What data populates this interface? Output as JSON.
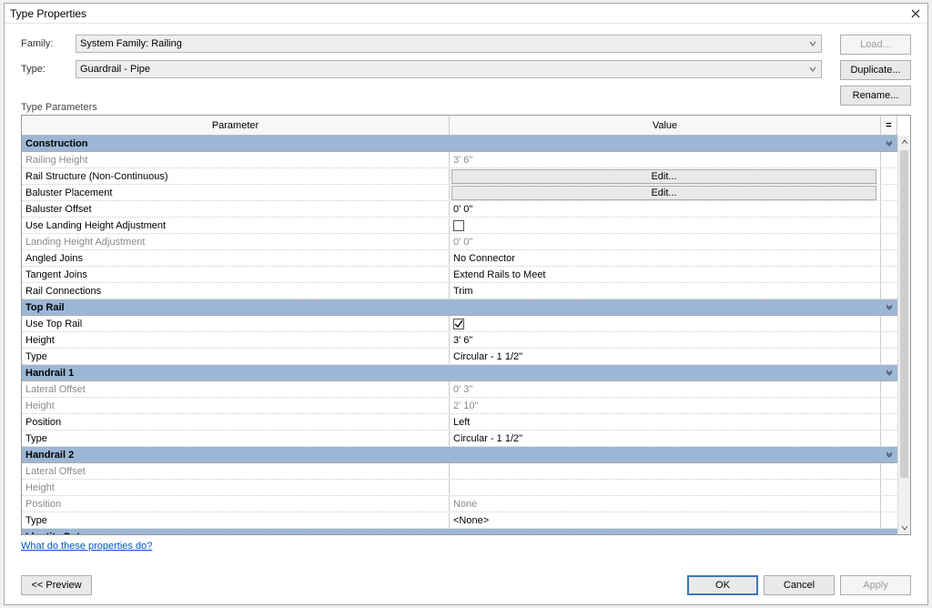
{
  "dialog": {
    "title": "Type Properties"
  },
  "labels": {
    "family": "Family:",
    "type": "Type:",
    "type_parameters": "Type Parameters"
  },
  "family_select": {
    "value": "System Family: Railing"
  },
  "type_select": {
    "value": "Guardrail - Pipe"
  },
  "buttons": {
    "load": "Load...",
    "duplicate": "Duplicate...",
    "rename": "Rename...",
    "preview": "<<  Preview",
    "ok": "OK",
    "cancel": "Cancel",
    "apply": "Apply",
    "edit": "Edit..."
  },
  "columns": {
    "parameter": "Parameter",
    "value": "Value",
    "eq": "="
  },
  "helplink": "What do these properties do?",
  "groups": [
    {
      "name": "Construction",
      "rows": [
        {
          "label": "Railing Height",
          "value": "3'  6\"",
          "dim": true
        },
        {
          "label": "Rail Structure (Non-Continuous)",
          "value": "",
          "edit": true
        },
        {
          "label": "Baluster Placement",
          "value": "",
          "edit": true
        },
        {
          "label": "Baluster Offset",
          "value": "0'  0\""
        },
        {
          "label": "Use Landing Height Adjustment",
          "value": "",
          "checkbox": true,
          "checked": false
        },
        {
          "label": "Landing Height Adjustment",
          "value": "0'  0\"",
          "dim": true
        },
        {
          "label": "Angled Joins",
          "value": "No Connector"
        },
        {
          "label": "Tangent Joins",
          "value": "Extend Rails to Meet"
        },
        {
          "label": "Rail Connections",
          "value": "Trim"
        }
      ]
    },
    {
      "name": "Top Rail",
      "rows": [
        {
          "label": "Use Top Rail",
          "value": "",
          "checkbox": true,
          "checked": true
        },
        {
          "label": "Height",
          "value": "3'  6\""
        },
        {
          "label": "Type",
          "value": "Circular - 1 1/2\""
        }
      ]
    },
    {
      "name": "Handrail 1",
      "rows": [
        {
          "label": "Lateral Offset",
          "value": "0'  3\"",
          "dim": true
        },
        {
          "label": "Height",
          "value": "2'  10\"",
          "dim": true
        },
        {
          "label": "Position",
          "value": "Left"
        },
        {
          "label": "Type",
          "value": "Circular - 1 1/2\""
        }
      ]
    },
    {
      "name": "Handrail 2",
      "rows": [
        {
          "label": "Lateral Offset",
          "value": "",
          "dim": true
        },
        {
          "label": "Height",
          "value": "",
          "dim": true
        },
        {
          "label": "Position",
          "value": "None",
          "dim": true
        },
        {
          "label": "Type",
          "value": "<None>"
        }
      ]
    },
    {
      "name": "Identity Data",
      "rows": []
    }
  ]
}
